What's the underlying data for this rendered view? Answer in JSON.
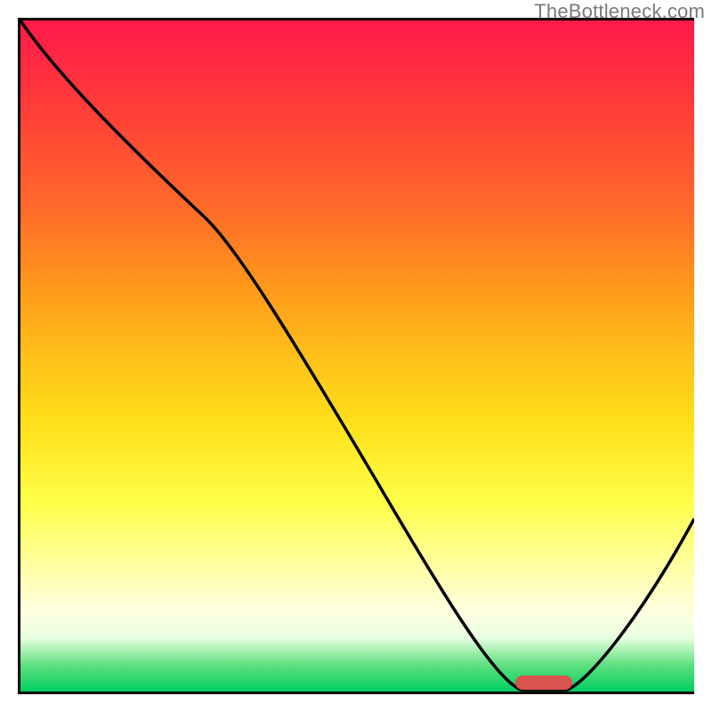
{
  "watermark": "TheBottleneck.com",
  "colors": {
    "curve": "#000000",
    "marker": "#d9534f",
    "gradient_top": "#ff1a4a",
    "gradient_bottom": "#00d060"
  },
  "chart_data": {
    "type": "line",
    "title": "",
    "xlabel": "",
    "ylabel": "",
    "xlim": [
      0,
      100
    ],
    "ylim": [
      0,
      100
    ],
    "x": [
      0,
      8,
      16,
      24,
      28,
      35,
      45,
      55,
      65,
      72,
      76,
      80,
      84,
      90,
      100
    ],
    "y": [
      100,
      92,
      84,
      76,
      70,
      58,
      42,
      26,
      10,
      2,
      0,
      0,
      2,
      10,
      28
    ],
    "marker": {
      "x_center": 78,
      "y": 0,
      "width_pct": 8
    },
    "note": "y in percent of plot height; higher = worse (red), 0 = best (green)"
  }
}
